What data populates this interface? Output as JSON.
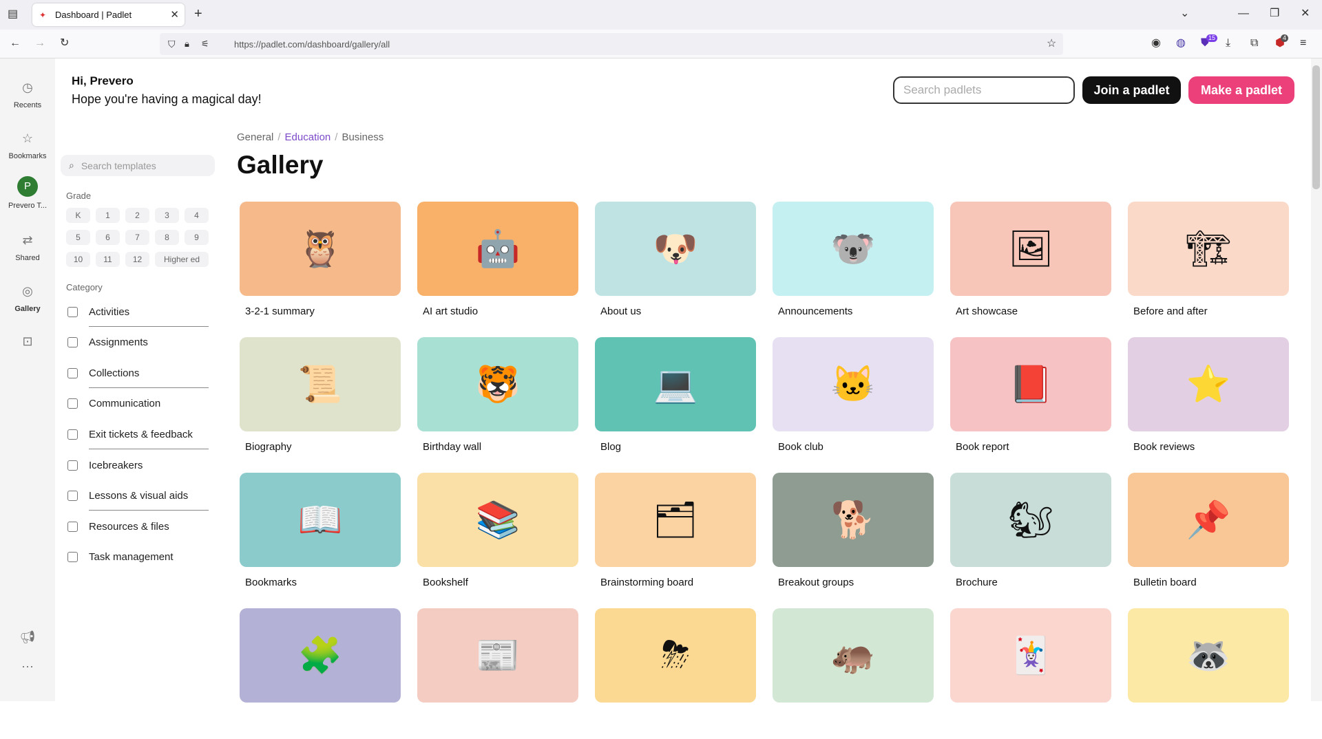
{
  "browser": {
    "tab_title": "Dashboard | Padlet",
    "url": "https://padlet.com/dashboard/gallery/all",
    "extension_badge_1": "15",
    "extension_badge_2": "4"
  },
  "rail": {
    "recents": "Recents",
    "bookmarks": "Bookmarks",
    "avatar_letter": "P",
    "account": "Prevero T...",
    "shared": "Shared",
    "gallery": "Gallery"
  },
  "header": {
    "greeting": "Hi, Prevero",
    "subgreeting": "Hope you're having a magical day!",
    "search_placeholder": "Search padlets",
    "join_label": "Join a padlet",
    "make_label": "Make a padlet"
  },
  "filters": {
    "search_placeholder": "Search templates",
    "grade_label": "Grade",
    "grades": [
      "K",
      "1",
      "2",
      "3",
      "4",
      "5",
      "6",
      "7",
      "8",
      "9",
      "10",
      "11",
      "12",
      "Higher ed"
    ],
    "category_label": "Category",
    "categories": [
      "Activities",
      "Assignments",
      "Collections",
      "Communication",
      "Exit tickets & feedback",
      "Icebreakers",
      "Lessons & visual aids",
      "Resources & files",
      "Task management"
    ]
  },
  "gallery": {
    "breadcrumbs": [
      "General",
      "Education",
      "Business"
    ],
    "active_crumb": "Education",
    "title": "Gallery",
    "templates": [
      {
        "title": "3-2-1 summary",
        "bg": "#f6b98a",
        "icon": "🦉"
      },
      {
        "title": "AI art studio",
        "bg": "#f9b068",
        "icon": "🤖"
      },
      {
        "title": "About us",
        "bg": "#bfe3e3",
        "icon": "🐶"
      },
      {
        "title": "Announcements",
        "bg": "#c5f0f2",
        "icon": "🐨"
      },
      {
        "title": "Art showcase",
        "bg": "#f7c6b8",
        "icon": "🖼"
      },
      {
        "title": "Before and after",
        "bg": "#fbd9c9",
        "icon": "🏗"
      },
      {
        "title": "Biography",
        "bg": "#dfe3cc",
        "icon": "📜"
      },
      {
        "title": "Birthday wall",
        "bg": "#a8e0d4",
        "icon": "🐯"
      },
      {
        "title": "Blog",
        "bg": "#5fc2b3",
        "icon": "💻"
      },
      {
        "title": "Book club",
        "bg": "#e6e0f2",
        "icon": "🐱"
      },
      {
        "title": "Book report",
        "bg": "#f7c2c4",
        "icon": "📕"
      },
      {
        "title": "Book reviews",
        "bg": "#e3cfe3",
        "icon": "⭐"
      },
      {
        "title": "Bookmarks",
        "bg": "#8ccbcc",
        "icon": "📖"
      },
      {
        "title": "Bookshelf",
        "bg": "#fae0a6",
        "icon": "📚"
      },
      {
        "title": "Brainstorming board",
        "bg": "#fbd3a3",
        "icon": "🗂"
      },
      {
        "title": "Breakout groups",
        "bg": "#8f9c92",
        "icon": "🐕"
      },
      {
        "title": "Brochure",
        "bg": "#c8ddd7",
        "icon": "🐿"
      },
      {
        "title": "Bulletin board",
        "bg": "#f9c795",
        "icon": "📌"
      },
      {
        "title": "",
        "bg": "#b3b1d6",
        "icon": "🧩"
      },
      {
        "title": "",
        "bg": "#f4ccc2",
        "icon": "📰"
      },
      {
        "title": "",
        "bg": "#fbd992",
        "icon": "⛈"
      },
      {
        "title": "",
        "bg": "#d3e7d5",
        "icon": "🦛"
      },
      {
        "title": "",
        "bg": "#fbd6cf",
        "icon": "🃏"
      },
      {
        "title": "",
        "bg": "#fde9a6",
        "icon": "🦝"
      }
    ]
  }
}
